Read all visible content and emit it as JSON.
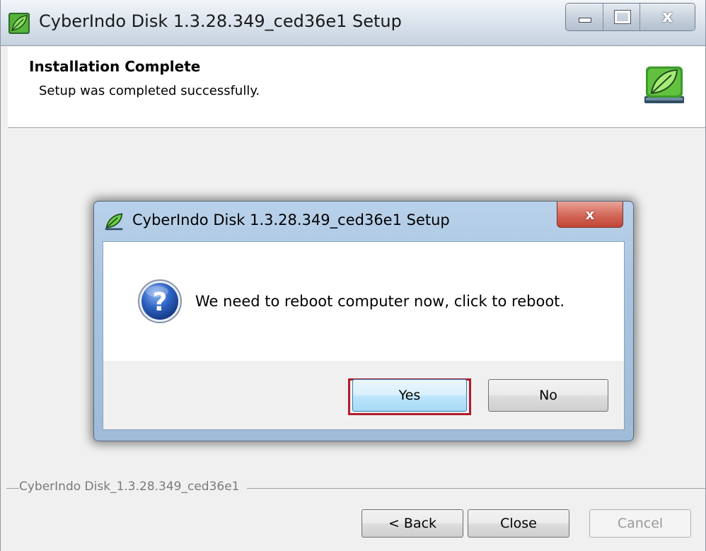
{
  "window": {
    "title": "CyberIndo Disk 1.3.28.349_ced36e1 Setup",
    "close_glyph": "x"
  },
  "header": {
    "title": "Installation Complete",
    "subtitle": "Setup was completed successfully.",
    "logo_icon": "leaf-disk-icon"
  },
  "group_label": "CyberIndo Disk_1.3.28.349_ced36e1",
  "buttons": {
    "back": "< Back",
    "close": "Close",
    "cancel": "Cancel"
  },
  "dialog": {
    "title": "CyberIndo Disk 1.3.28.349_ced36e1 Setup",
    "message": "We need to reboot computer now, click to reboot.",
    "icon": "question-icon",
    "close_glyph": "x",
    "yes": "Yes",
    "no": "No",
    "highlight_color": "#b21c2b"
  }
}
